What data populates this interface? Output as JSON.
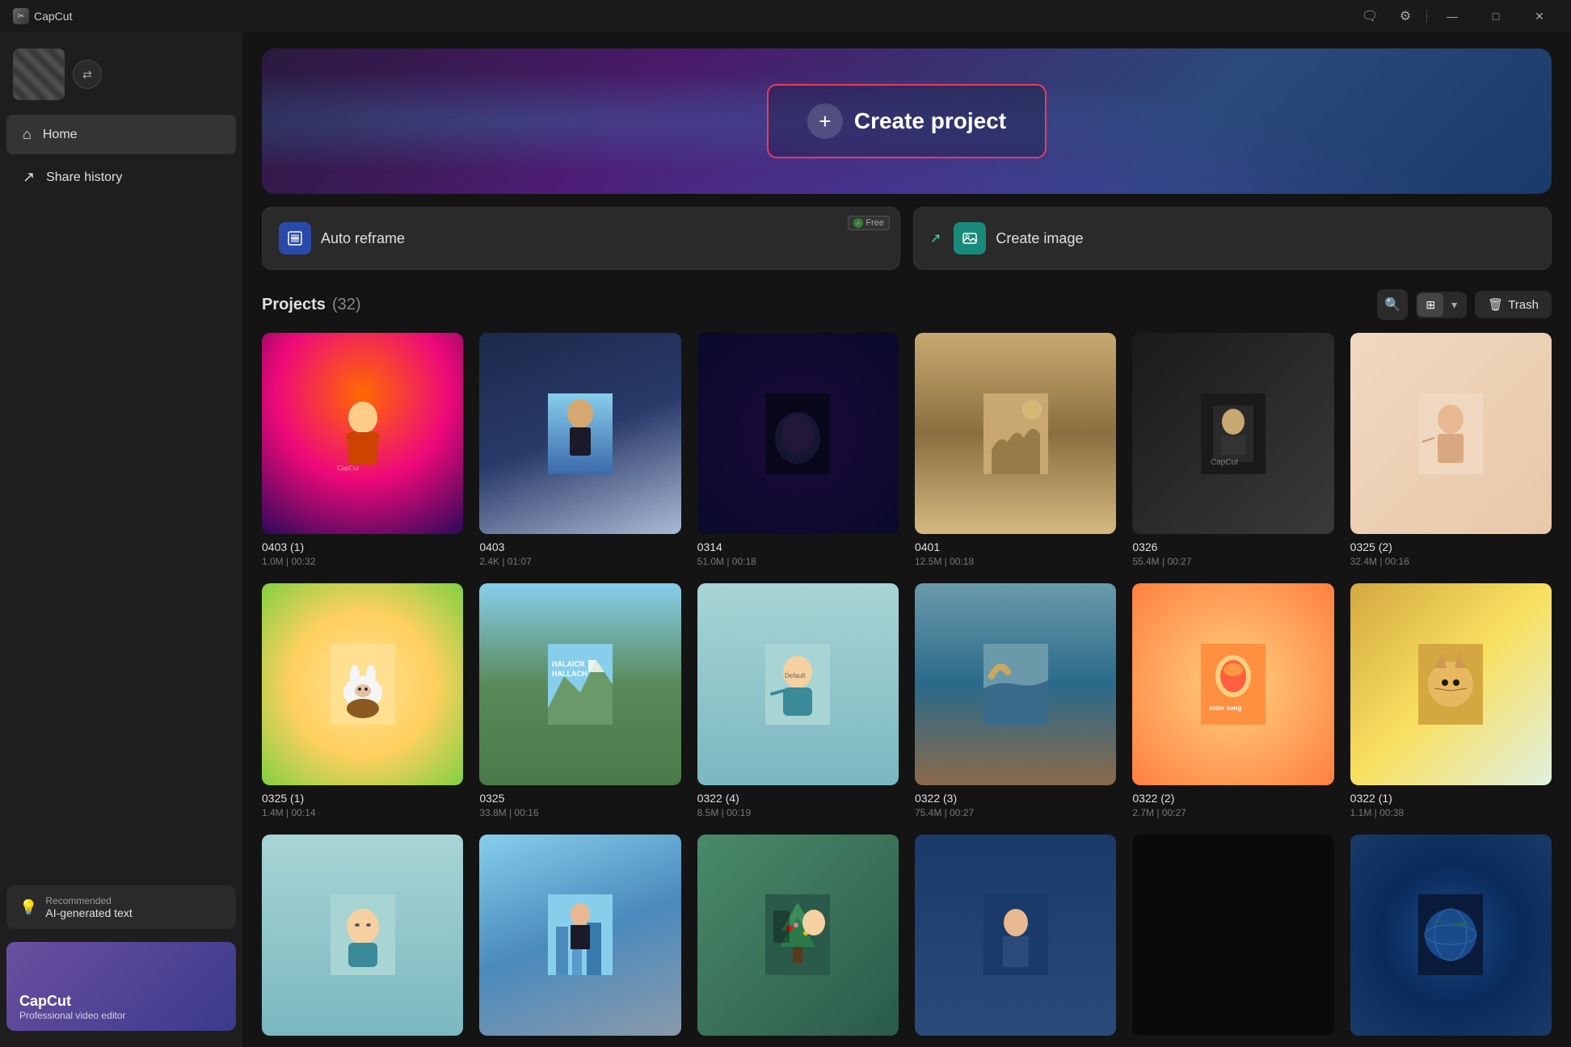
{
  "app": {
    "name": "CapCut",
    "icon": "✂"
  },
  "titlebar": {
    "feedback_icon": "💬",
    "settings_icon": "⚙",
    "minimize_label": "—",
    "maximize_label": "□",
    "close_label": "✕"
  },
  "sidebar": {
    "nav_items": [
      {
        "id": "home",
        "icon": "⌂",
        "label": "Home",
        "active": true
      },
      {
        "id": "share",
        "icon": "↗",
        "label": "Share history",
        "active": false
      }
    ],
    "recommendation": {
      "icon": "💡",
      "sub_label": "Recommended",
      "title": "AI-generated text"
    },
    "banner": {
      "title": "CapCut",
      "subtitle": "Professional video editor"
    }
  },
  "hero": {
    "create_project_label": "Create project"
  },
  "features": [
    {
      "id": "auto-reframe",
      "icon": "⊞",
      "icon_style": "blue",
      "label": "Auto reframe",
      "free": true,
      "arrow": false
    },
    {
      "id": "create-image",
      "icon": "🖼",
      "icon_style": "teal",
      "label": "Create image",
      "free": false,
      "arrow": true
    }
  ],
  "projects": {
    "title": "Projects",
    "count": 32,
    "trash_label": "Trash",
    "items": [
      {
        "id": "0403-1",
        "name": "0403 (1)",
        "meta": "1.0M | 00:32",
        "thumb_class": "thumb-char-hero"
      },
      {
        "id": "0403",
        "name": "0403",
        "meta": "2.4K | 01:07",
        "thumb_class": "thumb-0403"
      },
      {
        "id": "0314",
        "name": "0314",
        "meta": "51.0M | 00:18",
        "thumb_class": "thumb-0314"
      },
      {
        "id": "0401",
        "name": "0401",
        "meta": "12.5M | 00:18",
        "thumb_class": "thumb-0401"
      },
      {
        "id": "0326",
        "name": "0326",
        "meta": "55.4M | 00:27",
        "thumb_class": "thumb-0326"
      },
      {
        "id": "0325-2",
        "name": "0325 (2)",
        "meta": "32.4M | 00:16",
        "thumb_class": "thumb-0325-2"
      },
      {
        "id": "0325-1",
        "name": "0325 (1)",
        "meta": "1.4M | 00:14",
        "thumb_class": "thumb-bunny"
      },
      {
        "id": "0325",
        "name": "0325",
        "meta": "33.8M | 00:16",
        "thumb_class": "thumb-mountain"
      },
      {
        "id": "0322-4",
        "name": "0322 (4)",
        "meta": "8.5M | 00:19",
        "thumb_class": "thumb-default"
      },
      {
        "id": "0322-3",
        "name": "0322 (3)",
        "meta": "75.4M | 00:27",
        "thumb_class": "thumb-coastal"
      },
      {
        "id": "0322-2",
        "name": "0322 (2)",
        "meta": "2.7M | 00:27",
        "thumb_class": "thumb-easter-song"
      },
      {
        "id": "0322-1",
        "name": "0322 (1)",
        "meta": "1.1M | 00:38",
        "thumb_class": "thumb-cat"
      },
      {
        "id": "row3-1",
        "name": "",
        "meta": "",
        "thumb_class": "thumb-face"
      },
      {
        "id": "row3-2",
        "name": "",
        "meta": "",
        "thumb_class": "thumb-city-person"
      },
      {
        "id": "row3-3",
        "name": "",
        "meta": "",
        "thumb_class": "thumb-xmas"
      },
      {
        "id": "row3-4",
        "name": "",
        "meta": "",
        "thumb_class": "thumb-person-dark"
      },
      {
        "id": "row3-5",
        "name": "",
        "meta": "",
        "thumb_class": "thumb-black"
      },
      {
        "id": "row3-6",
        "name": "",
        "meta": "",
        "thumb_class": "thumb-globe"
      }
    ]
  }
}
